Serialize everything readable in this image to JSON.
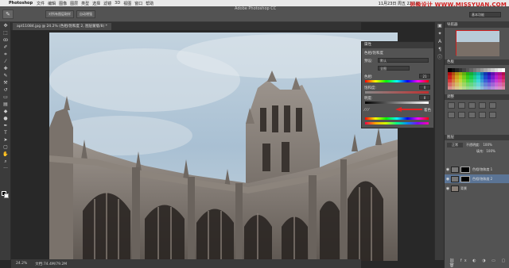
{
  "menubar": {
    "app_name": "Photoshop",
    "items": [
      "文件",
      "编辑",
      "图像",
      "图层",
      "类型",
      "选择",
      "滤镜",
      "3D",
      "视图",
      "窗口",
      "帮助"
    ],
    "clock": "11月23日 周五 22:19",
    "watermark": "思缘设计 WWW.MISSYUAN.COM"
  },
  "options_bar": {
    "buttons": [
      "对所有图层取样",
      "自动增强"
    ],
    "window_title": "Adobe Photoshop CC",
    "workspace": "基本功能"
  },
  "document": {
    "tab": "apt11084.jpg @ 24.2% (色相/饱和度 2, 图层蒙版/8) *"
  },
  "status": {
    "zoom": "24.2%",
    "doc_size": "文档:74.4M/79.2M"
  },
  "properties": {
    "title": "属性",
    "panel_label": "色相/饱和度",
    "preset_label": "预设:",
    "preset_value": "默认",
    "channel_value": "全图",
    "hue_label": "色相:",
    "hue_value": "21",
    "saturation_label": "饱和度:",
    "saturation_value": "0",
    "lightness_label": "明度:",
    "lightness_value": "0",
    "colorize_label": "着色"
  },
  "right_panels": {
    "navigator_title": "导航器",
    "swatches_title": "色板",
    "adjustments_title": "调整",
    "layers_title": "图层",
    "layer_mode": "正常",
    "opacity_label": "不透明度:",
    "opacity_value": "100%",
    "fill_label": "填充:",
    "fill_value": "100%",
    "layers": [
      {
        "name": "色相/饱和度 1",
        "selected": false
      },
      {
        "name": "色相/饱和度 2",
        "selected": true
      },
      {
        "name": "背景",
        "selected": false
      }
    ]
  },
  "colors": {
    "accent_red": "#d82c2c",
    "panel_bg": "#535353",
    "selection": "#5b7495"
  }
}
